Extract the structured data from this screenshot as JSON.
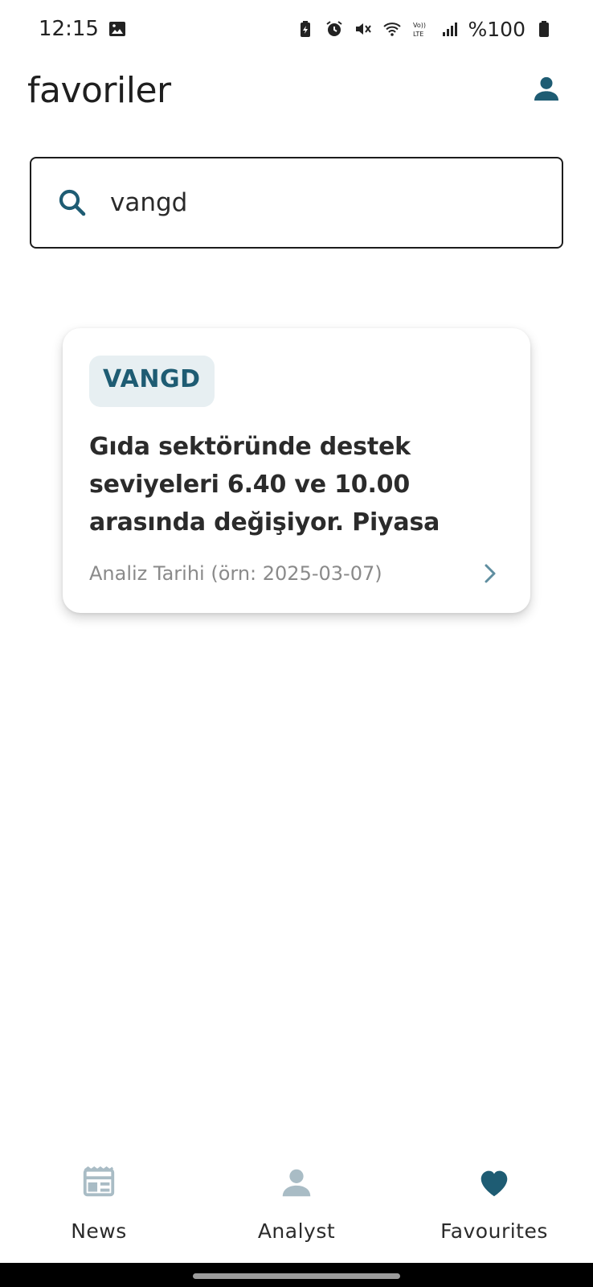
{
  "status_bar": {
    "time": "12:15",
    "battery": "%100",
    "icons": [
      "image-notification-icon",
      "battery-saver-icon",
      "alarm-icon",
      "mute-icon",
      "wifi-icon",
      "volte-icon",
      "signal-icon",
      "battery-icon"
    ]
  },
  "app_bar": {
    "title": "favoriler",
    "profile_icon": "person-icon"
  },
  "search": {
    "value": "vangd",
    "icon": "search-icon"
  },
  "results": [
    {
      "ticker": "VANGD",
      "summary": "Gıda sektöründe destek seviyeleri 6.40 ve 10.00 arasında değişiyor. Piyasa dalgalanmaları ve manip…",
      "date_label": "Analiz Tarihi (örn: 2025-03-07)"
    }
  ],
  "bottom_nav": {
    "items": [
      {
        "label": "News",
        "icon": "newspaper-icon",
        "active": false
      },
      {
        "label": "Analyst",
        "icon": "person-icon",
        "active": false
      },
      {
        "label": "Favourites",
        "icon": "heart-icon",
        "active": true
      }
    ]
  },
  "colors": {
    "accent": "#1e5c73",
    "inactive_icon": "#a9bcc5",
    "badge_bg": "#e7eff2",
    "text_primary": "#1f1f1f",
    "text_secondary": "#8a8a8a"
  }
}
